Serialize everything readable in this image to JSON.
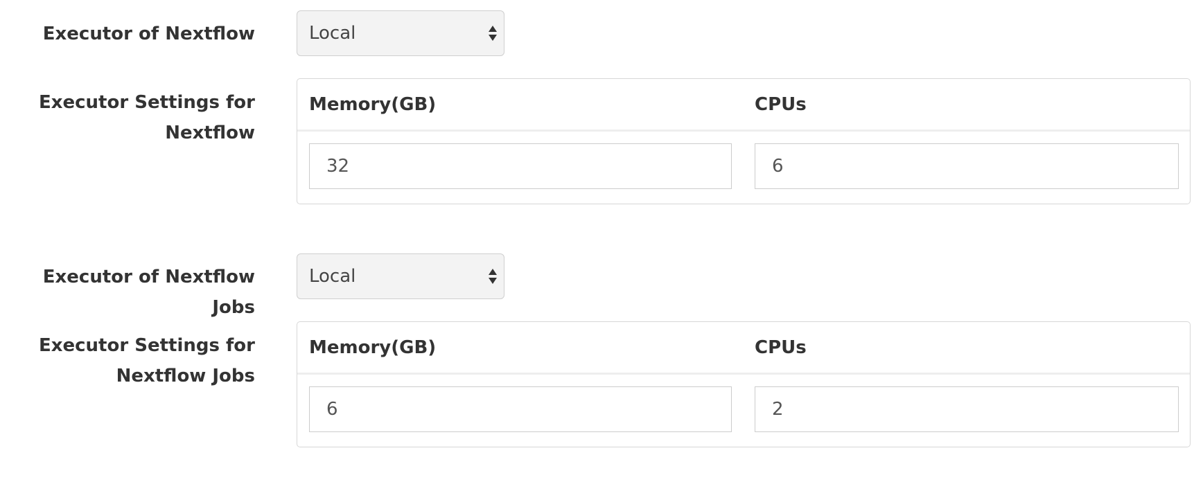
{
  "nextflow": {
    "executor_label": "Executor of Nextflow",
    "executor_value": "Local",
    "settings_label_line1": "Executor Settings for",
    "settings_label_line2": "Nextflow",
    "memory_header": "Memory(GB)",
    "cpus_header": "CPUs",
    "memory_value": "32",
    "cpus_value": "6"
  },
  "jobs": {
    "executor_label": "Executor of Nextflow Jobs",
    "executor_value": "Local",
    "settings_label_line1": "Executor Settings for",
    "settings_label_line2": "Nextflow Jobs",
    "memory_header": "Memory(GB)",
    "cpus_header": "CPUs",
    "memory_value": "6",
    "cpus_value": "2"
  },
  "icons": {
    "select_arrows": "up-down-arrows-icon"
  }
}
